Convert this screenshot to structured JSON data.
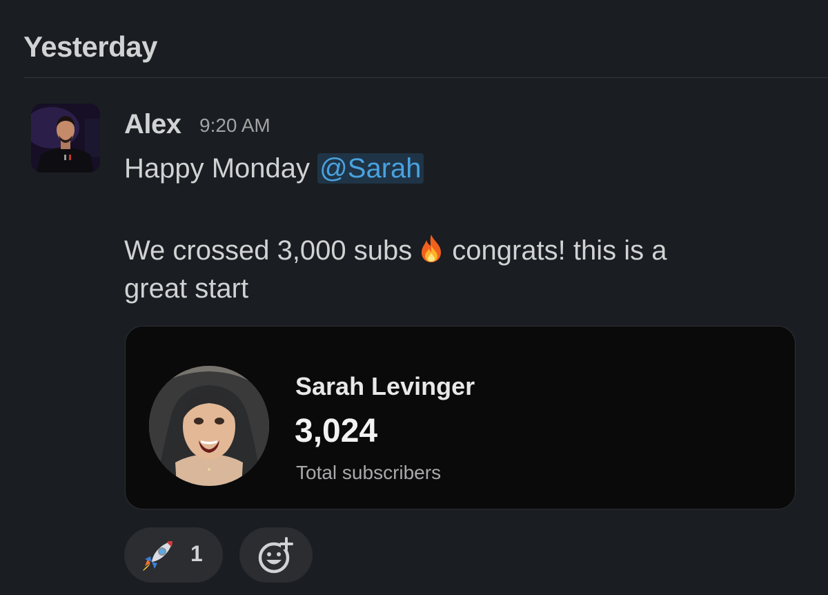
{
  "day_divider": {
    "label": "Yesterday"
  },
  "message": {
    "sender": "Alex",
    "time": "9:20 AM",
    "line1_prefix": "Happy Monday ",
    "mention": "@Sarah",
    "line2_prefix": "We crossed 3,000 subs",
    "line2_emoji": "fire-emoji",
    "line2_suffix": "congrats! this is a",
    "line3": "great start"
  },
  "card": {
    "name": "Sarah Levinger",
    "count": "3,024",
    "label": "Total subscribers"
  },
  "reactions": [
    {
      "emoji": "rocket-emoji",
      "count": "1"
    }
  ],
  "add_reaction": {
    "icon": "add-reaction-icon"
  },
  "colors": {
    "background": "#1a1d21",
    "mention_text": "#4aa2e0",
    "mention_bg": "#1f3446",
    "card_bg": "#0a0a0b",
    "pill_bg": "#2b2d31"
  }
}
